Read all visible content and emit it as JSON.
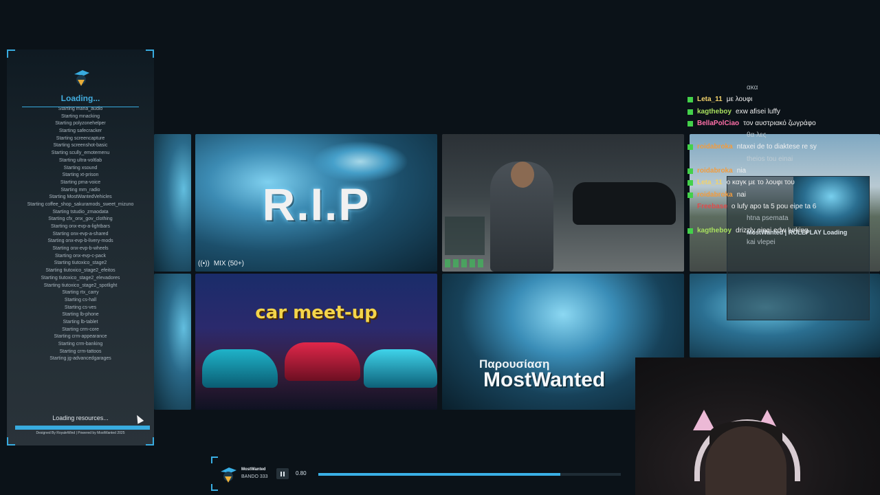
{
  "loader": {
    "title": "Loading...",
    "resources": [
      "Starting mana_audio",
      "Starting mnacking",
      "Starting polyzonehelper",
      "Starting safecracker",
      "Starting screencapture",
      "Starting screenshot-basic",
      "Starting scully_emotemenu",
      "Starting ultra-voltlab",
      "Starting xsound",
      "Starting xt-prison",
      "Starting pma-voice",
      "Starting mm_radio",
      "Starting MostWantedVehicles",
      "Starting coffee_shop_sakuramods_sweet_mizuno",
      "Starting tstudio_zmaodata",
      "Starting cfx_onx_gov_clothing",
      "Starting onx-evp-a-lightbars",
      "Starting onx-evp-a-shared",
      "Starting onx-evp-b-livery-mods",
      "Starting onx-evp-b-wheels",
      "Starting onx-evp-c-pack",
      "Starting tiutoxico_stage2",
      "Starting tiutoxico_stage2_efeitos",
      "Starting tiutoxico_stage2_elevadores",
      "Starting tiutoxico_stage2_spotlight",
      "Starting rtx_carry",
      "Starting cs-hall",
      "Starting cs-ves",
      "Starting lb-phone",
      "Starting lb-tablet",
      "Starting crm-core",
      "Starting crm-appearance",
      "Starting crm-banking",
      "Starting crm-tattoos",
      "Starting jg-advancedgarages"
    ],
    "status": "Loading resources...",
    "progress": 1.0,
    "credits": "Designed By RoyaleWind | Powered by MostWanted 2025",
    "accent": "#3ab0e6"
  },
  "gallery": {
    "rip_caption": "R.I.P",
    "mix_label": "MIX (50+)",
    "car_caption": "car meet-up",
    "mw_subtitle": "Παρουσίαση",
    "mw_title": "MostWanted"
  },
  "chat": {
    "lines": [
      {
        "user": "",
        "msg": "ακα",
        "color": "#c6d0d6",
        "badge": false
      },
      {
        "user": "Leta_11",
        "msg": "με λουφι",
        "color": "#f3d36b",
        "badge": true
      },
      {
        "user": "kagtheboy",
        "msg": "exw afisei luffy",
        "color": "#a8e05f",
        "badge": true
      },
      {
        "user": "BellaPolCiao",
        "msg": "τον αυστριακό ζωγράφο",
        "color": "#ff6fa8",
        "badge": true
      },
      {
        "user": "",
        "msg": "θα λες",
        "color": "#c6d0d6",
        "badge": false
      },
      {
        "user": "roidabroka",
        "msg": "ntaxei de to diaktese re sy",
        "color": "#f39c3c",
        "badge": true
      },
      {
        "user": "",
        "msg": "theios tou einai",
        "color": "#c6d0d6",
        "badge": false
      },
      {
        "user": "roidabroka",
        "msg": "nia",
        "color": "#f39c3c",
        "badge": true
      },
      {
        "user": "Leta_11",
        "msg": "ο καγκ με το λουφι του",
        "color": "#f3d36b",
        "badge": true
      },
      {
        "user": "roidabroka",
        "msg": "nai",
        "color": "#f39c3c",
        "badge": true
      },
      {
        "user": "Freebase",
        "msg": "o lufy apo ta 5 pou eipe ta 6",
        "color": "#e04b4b",
        "badge": false
      },
      {
        "user": "",
        "msg": "htna psemata",
        "color": "#c6d0d6",
        "badge": false
      },
      {
        "user": "kagtheboy",
        "msg": "drizzly einai edw lurking",
        "color": "#a8e05f",
        "badge": true
      },
      {
        "user": "",
        "msg": "kai vlepei",
        "color": "#c6d0d6",
        "badge": false
      }
    ],
    "preview_title": "MostWanted | ROLEPLAY Loading"
  },
  "player": {
    "artist": "MostWanted",
    "track": "BANDO 333",
    "volume": "0.80",
    "track_progress": 0.8
  }
}
